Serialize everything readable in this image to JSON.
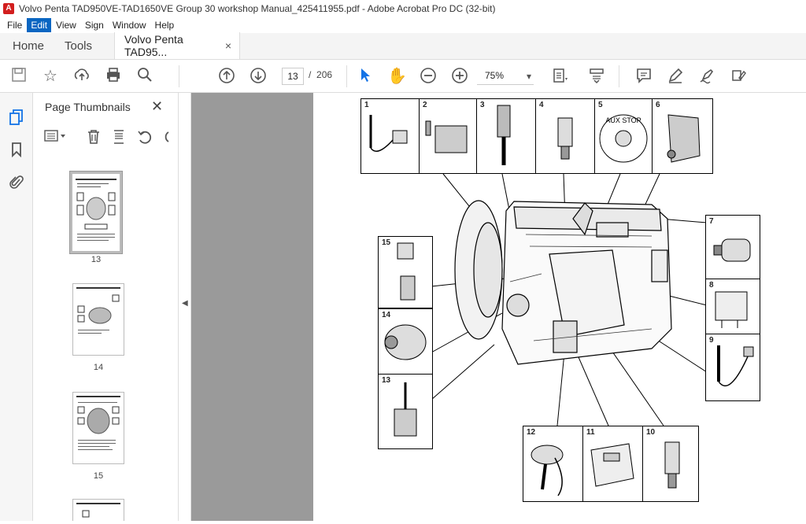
{
  "window": {
    "title": "Volvo Penta TAD950VE-TAD1650VE Group 30 workshop Manual_425411955.pdf - Adobe Acrobat Pro DC (32-bit)"
  },
  "menu": [
    "File",
    "Edit",
    "View",
    "Sign",
    "Window",
    "Help"
  ],
  "tabs": {
    "home": "Home",
    "tools": "Tools",
    "doc": "Volvo Penta TAD95...",
    "close": "×"
  },
  "toolbar": {
    "page_current": "13",
    "page_sep": "/",
    "page_total": "206",
    "zoom": "75%"
  },
  "thumbnails": {
    "title": "Page Thumbnails",
    "close": "✕",
    "pages": [
      "13",
      "14",
      "15"
    ]
  },
  "diagram": {
    "callouts": [
      "1",
      "2",
      "3",
      "4",
      "5",
      "6",
      "7",
      "8",
      "9",
      "10",
      "11",
      "12",
      "13",
      "14",
      "15"
    ],
    "stop_label": "AUX STOP"
  }
}
